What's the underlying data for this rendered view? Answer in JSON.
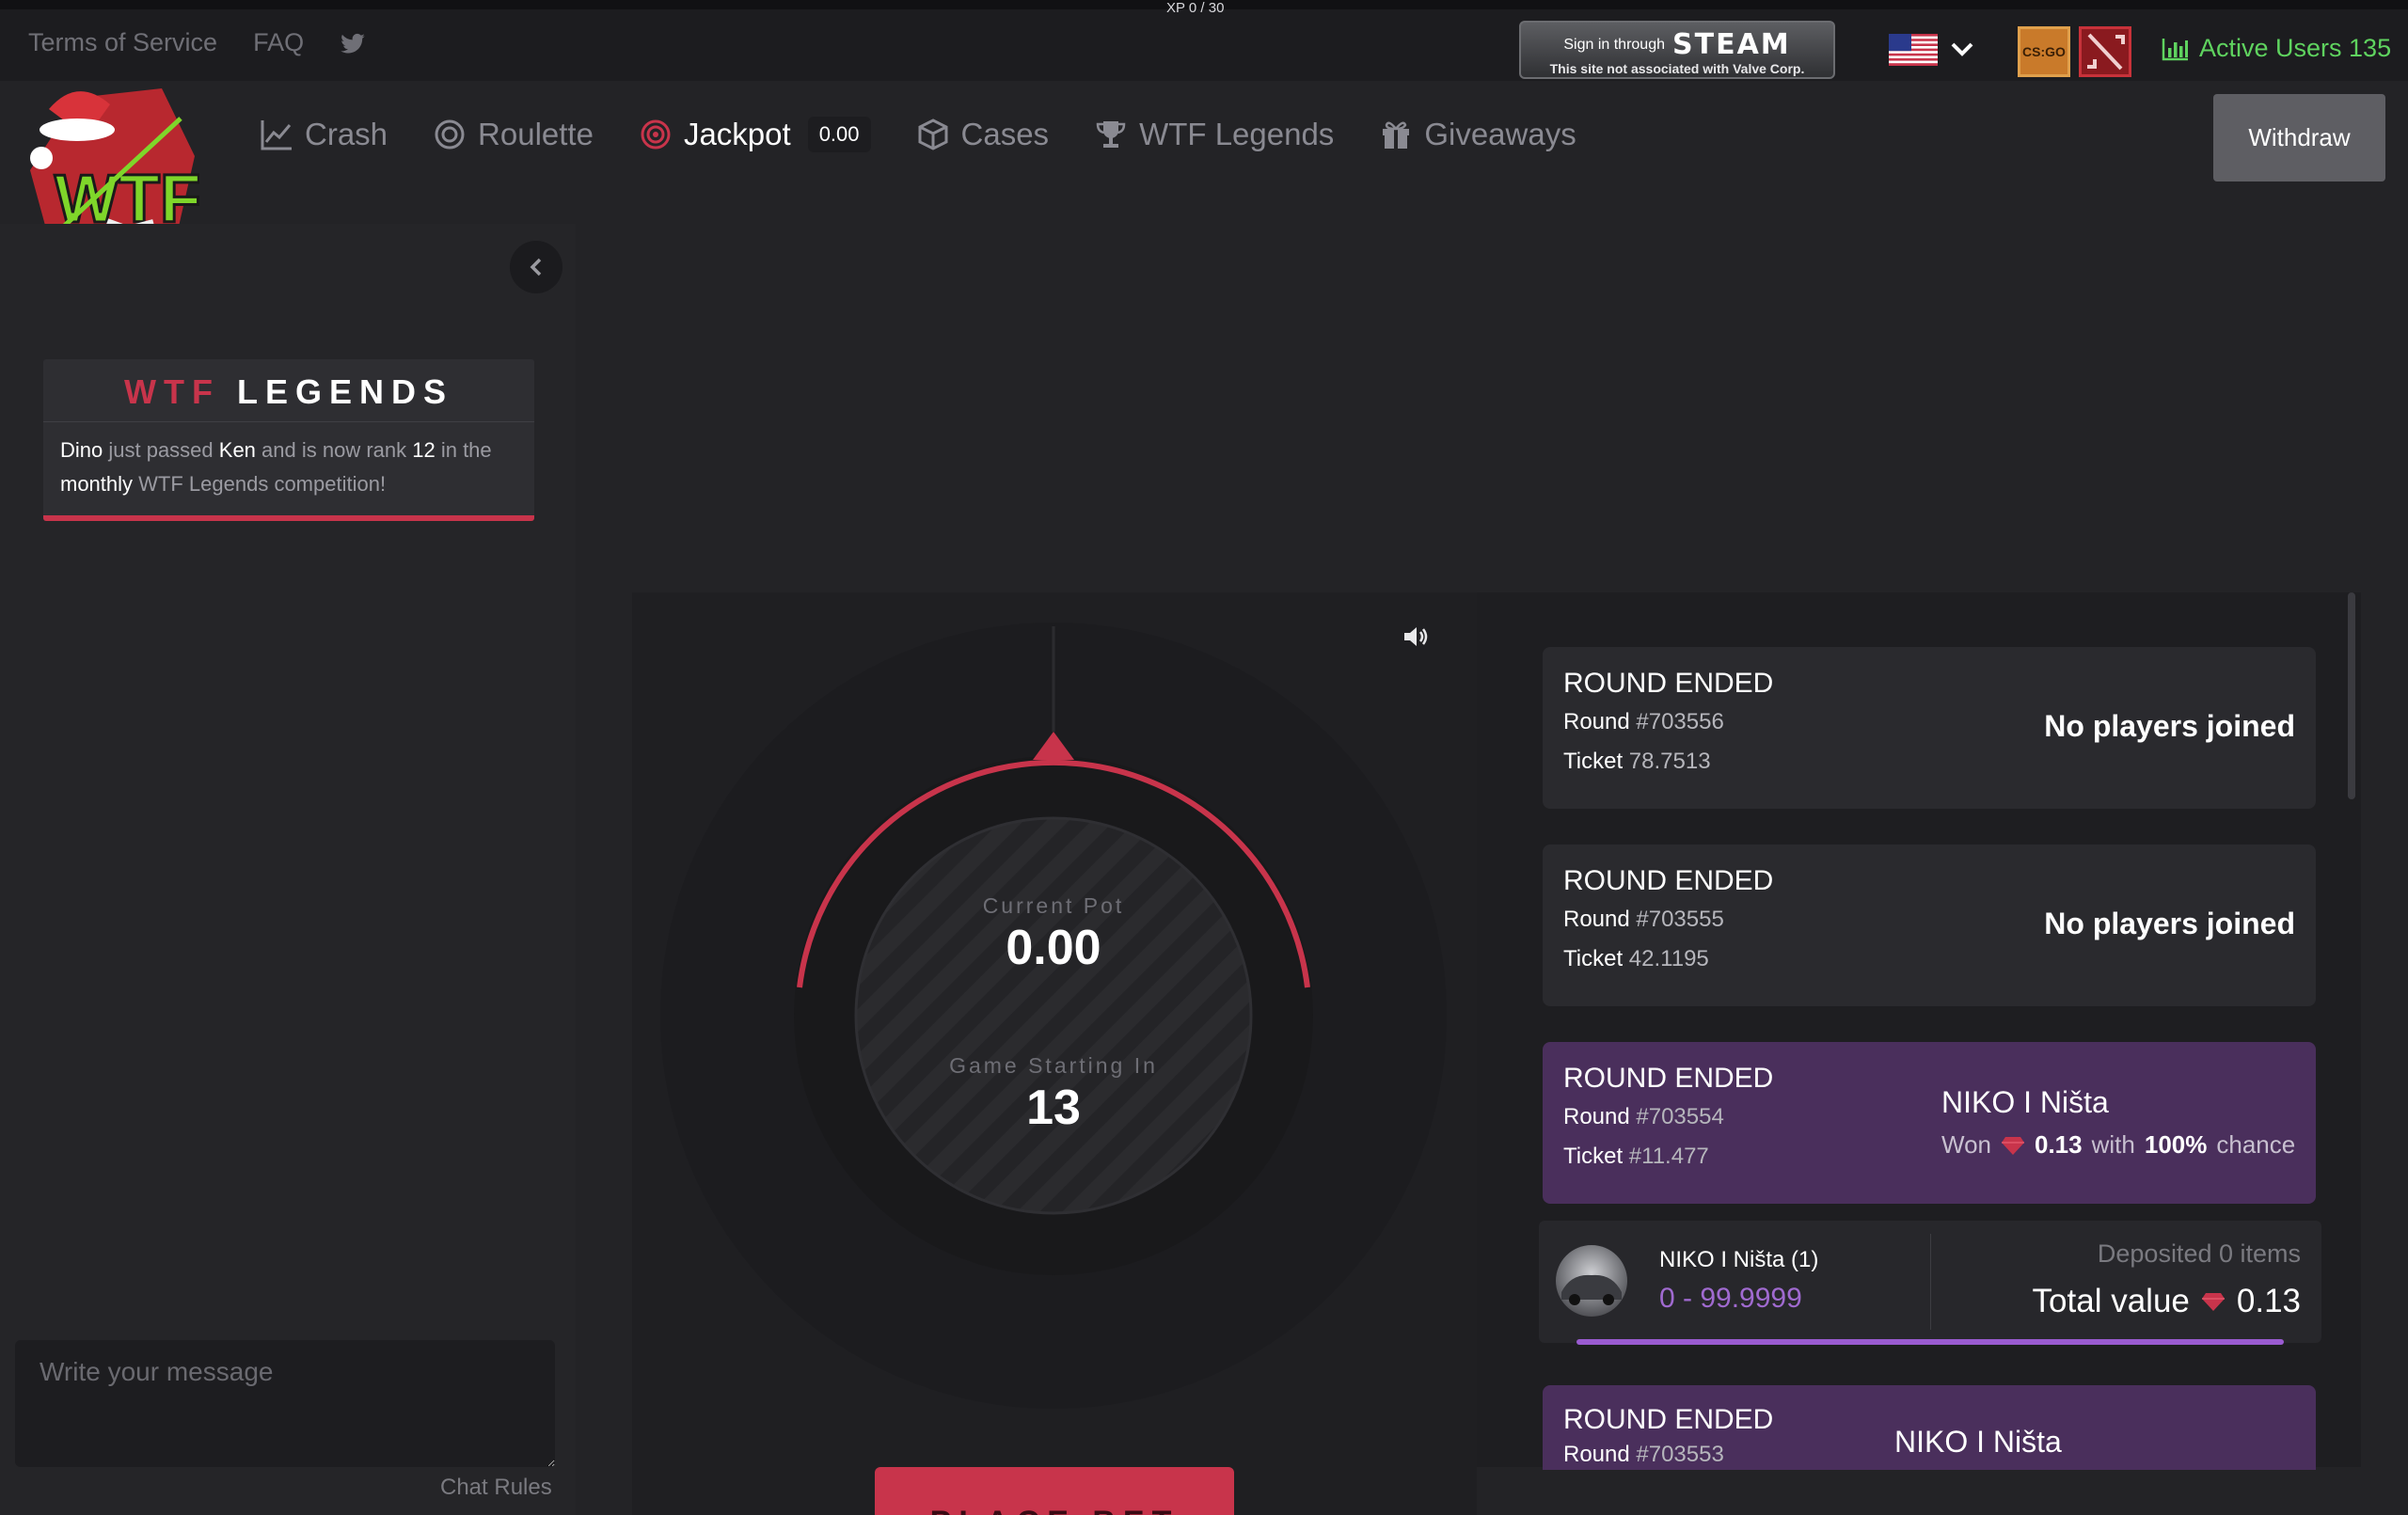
{
  "topbar": {
    "xp": "XP 0 / 30",
    "links": [
      "Terms of Service",
      "FAQ"
    ],
    "steam": {
      "line1": "Sign in through",
      "brand": "STEAM",
      "line2": "This site not associated with Valve Corp."
    },
    "csgo_label": "CS:GO",
    "active_users_label": "Active Users 135"
  },
  "nav": {
    "items": [
      {
        "label": "Crash",
        "icon": "chart-line-icon"
      },
      {
        "label": "Roulette",
        "icon": "roulette-icon"
      },
      {
        "label": "Jackpot",
        "icon": "jackpot-icon",
        "badge": "0.00"
      },
      {
        "label": "Cases",
        "icon": "cube-icon"
      },
      {
        "label": "WTF Legends",
        "icon": "trophy-icon"
      },
      {
        "label": "Giveaways",
        "icon": "gift-icon"
      }
    ],
    "withdraw_label": "Withdraw"
  },
  "sidebar": {
    "legends_title_a": "WTF",
    "legends_title_b": "LEGENDS",
    "msg": {
      "p1": "Dino",
      "p2": " just passed ",
      "p3": "Ken",
      "p4": " and is now rank ",
      "p5": "12",
      "p6": " in the ",
      "p7": "monthly",
      "p8": " WTF Legends competition!"
    },
    "chat_placeholder": "Write your message",
    "chat_rules": "Chat Rules"
  },
  "game": {
    "pot_label": "Current Pot",
    "pot_value": "0.00",
    "start_label": "Game Starting In",
    "start_value": "13",
    "place_bet": "PLACE BET"
  },
  "rounds": [
    {
      "title": "ROUND ENDED",
      "round_label": "Round ",
      "round": "#703556",
      "ticket_label": "Ticket ",
      "ticket": "78.7513",
      "result": "No players joined"
    },
    {
      "title": "ROUND ENDED",
      "round_label": "Round ",
      "round": "#703555",
      "ticket_label": "Ticket ",
      "ticket": "42.1195",
      "result": "No players joined"
    },
    {
      "title": "ROUND ENDED",
      "round_label": "Round ",
      "round": "#703554",
      "ticket_label": "Ticket ",
      "ticket": "#11.477",
      "winner": "NIKO I Ništa",
      "won_label": "Won",
      "won_amount": "0.13",
      "with_label": "with",
      "chance": "100%",
      "chance_label": "chance"
    },
    {
      "title": "ROUND ENDED",
      "round_label": "Round ",
      "round": "#703553",
      "winner": "NIKO I Ništa"
    }
  ],
  "deposit": {
    "name": "NIKO I Ništa (1)",
    "range": "0 - 99.9999",
    "items": "Deposited 0 items",
    "total_label": "Total value",
    "total_value": "0.13"
  },
  "colors": {
    "accent_red": "#c8344b",
    "purple": "#4a2f5c",
    "green": "#5fd35f"
  }
}
